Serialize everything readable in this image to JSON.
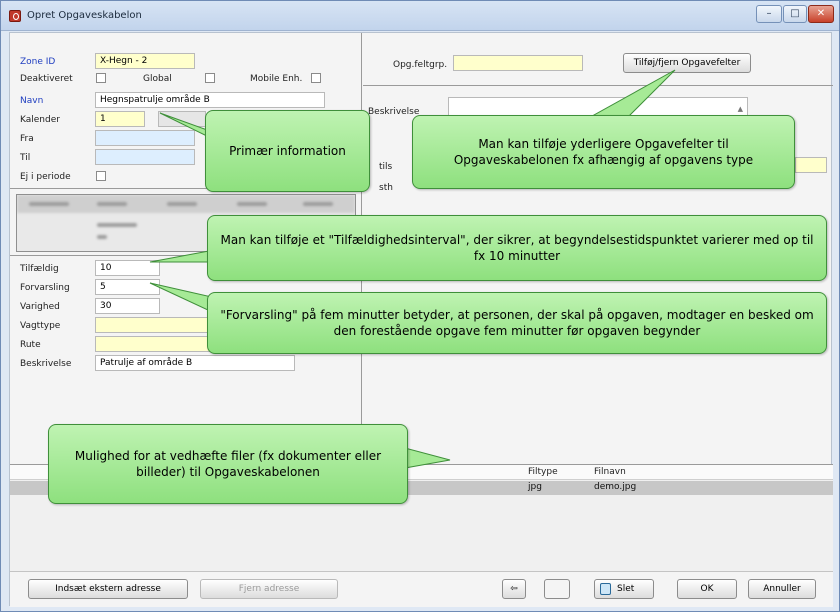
{
  "window": {
    "title": "Opret Opgaveskabelon",
    "minimize": "–",
    "maximize": "□",
    "close": "✕"
  },
  "left": {
    "zone_id_label": "Zone ID",
    "zone_id_value": "X-Hegn - 2",
    "deaktiveret_label": "Deaktiveret",
    "global_label": "Global",
    "mobile_label": "Mobile Enh.",
    "navn_label": "Navn",
    "navn_value": "Hegnspatrulje område B",
    "kalender_label": "Kalender",
    "kalender_value": "1",
    "fra_label": "Fra",
    "til_label": "Til",
    "ej_i_periode_label": "Ej i periode",
    "tilfaeldig_label": "Tilfældig",
    "tilfaeldig_value": "10",
    "forvarsling_label": "Forvarsling",
    "forvarsling_value": "5",
    "varighed_label": "Varighed",
    "varighed_value": "30",
    "vagttype_label": "Vagttype",
    "rute_label": "Rute",
    "beskrivelse_label": "Beskrivelse",
    "beskrivelse_value": "Patrulje af område B"
  },
  "right": {
    "opg_feltgrp_label": "Opg.feltgrp.",
    "tilfoej_button": "Tilføj/fjern Opgavefelter",
    "beskrivelse_label": "Beskrivelse",
    "partial_label_1": "tils",
    "partial_label_2": "sth"
  },
  "grid": {
    "columns": [
      "Filtype",
      "Filnavn"
    ],
    "rows": [
      {
        "filtype": "jpg",
        "filnavn": "demo.jpg"
      }
    ]
  },
  "footer": {
    "indsaet_button": "Indsæt ekstern adresse",
    "fjern_button": "Fjern adresse",
    "arrow_icon": "⇦",
    "slet_button": "Slet",
    "ok_button": "OK",
    "annuller_button": "Annuller"
  },
  "callouts": {
    "primaer": "Primær information",
    "opgavefelter": "Man kan tilføje yderligere Opgavefelter til Opgaveskabelonen fx afhængig af opgavens type",
    "tilfaeldig": "Man kan tilføje et \"Tilfældighedsinterval\", der sikrer, at begyndelsestidspunktet varierer med op til fx 10 minutter",
    "forvarsling": "\"Forvarsling\" på fem minutter betyder, at personen, der skal på opgaven, modtager en besked om den forestående opgave fem minutter før opgaven begynder",
    "filer": "Mulighed for at vedhæfte filer (fx dokumenter eller billeder) til Opgaveskabelonen"
  },
  "colors": {
    "callout_fill": "#9fe890",
    "field_yellow": "#ffffcc",
    "field_light_blue": "#ddeefe",
    "label_blue": "#1f3ec0"
  }
}
